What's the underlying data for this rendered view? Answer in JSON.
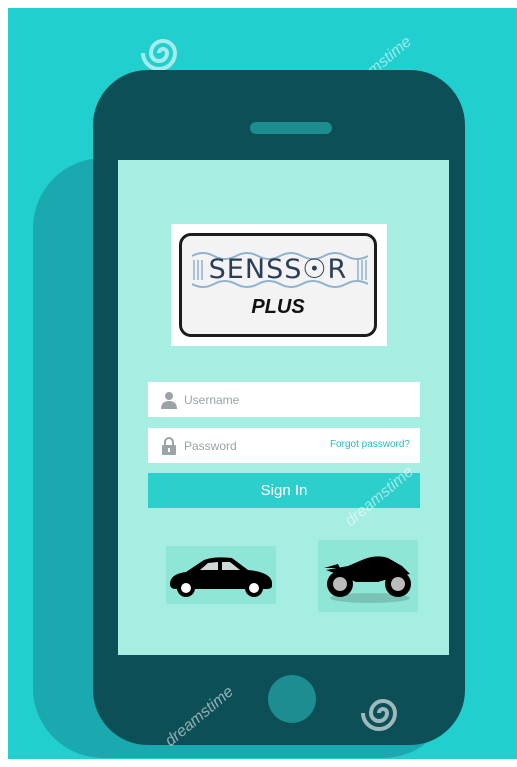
{
  "colors": {
    "background": "#22cfcf",
    "phone_body": "#0d4f57",
    "screen": "#a6eee1",
    "sign_in_button": "#2ccfcc",
    "forgot_link": "#29b9be"
  },
  "logo": {
    "brand": "SENSS☉R",
    "subtitle": "PLUS"
  },
  "login": {
    "username_placeholder": "Username",
    "password_placeholder": "Password",
    "forgot_password_label": "Forgot password?",
    "sign_in_label": "Sign In"
  },
  "vehicles": [
    {
      "icon": "car-icon"
    },
    {
      "icon": "motorcycle-icon"
    }
  ],
  "watermarks": [
    "dreamstime",
    "dreamstime",
    "dreamstime",
    "dreamstime"
  ]
}
